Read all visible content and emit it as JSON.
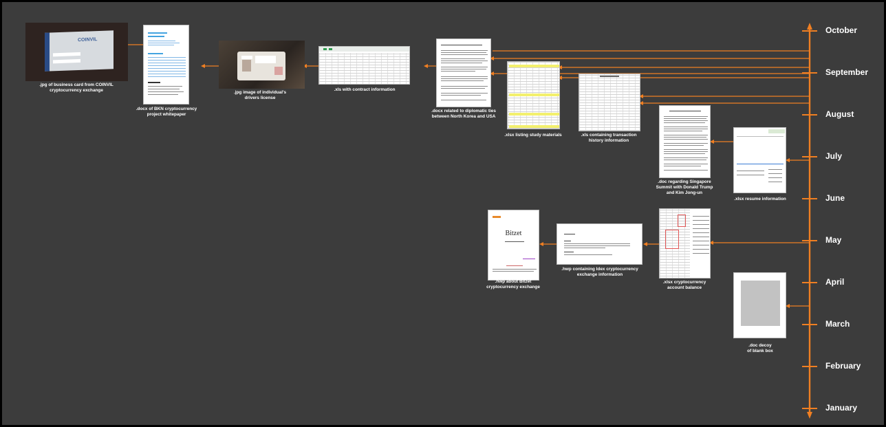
{
  "months": [
    "October",
    "September",
    "August",
    "July",
    "June",
    "May",
    "April",
    "March",
    "February",
    "January"
  ],
  "documents": {
    "business_card": {
      "caption_1": ".jpg of business card from COINVIL",
      "caption_2": "cryptocurrency exchange",
      "logo_text": "COINVIL"
    },
    "bkn_whitepaper": {
      "caption_1": ".docx of BKN cryptocurrency",
      "caption_2": "project whitepaper"
    },
    "drivers_license": {
      "caption_1": ".jpg image of individual's",
      "caption_2": "drivers license"
    },
    "contract_xls": {
      "caption_1": ".xls with contract information"
    },
    "diplomatic_docx": {
      "caption_1": ".docx related to diplomatic ties",
      "caption_2": "between North Korea and USA"
    },
    "study_xlsx": {
      "caption_1": ".xlsx listing study materials"
    },
    "transaction_xls": {
      "caption_1": ".xls containing transaction",
      "caption_2": "history information"
    },
    "singapore_doc": {
      "caption_1": ".doc regarding Singapore",
      "caption_2": "Summit with Donald Trump",
      "caption_3": "and Kim Jong-un"
    },
    "resume_xlsx": {
      "caption_1": ".xlsx resume information"
    },
    "bitzet_hwp": {
      "caption_1": ".hwp about Bitzet",
      "caption_2": "cryptocurrency exchange",
      "title_text": "Bitzet"
    },
    "idex_hwp": {
      "caption_1": ".hwp containing Idex cryptocurrency",
      "caption_2": "exchange information"
    },
    "balance_xlsx": {
      "caption_1": ".xlsx cryptocurrency",
      "caption_2": "account balance"
    },
    "decoy_doc": {
      "caption_1": ".doc decoy",
      "caption_2": "of blank box"
    }
  },
  "colors": {
    "background": "#3c3c3c",
    "frame": "#000000",
    "timeline": "#f07f22",
    "text": "#ffffff"
  }
}
